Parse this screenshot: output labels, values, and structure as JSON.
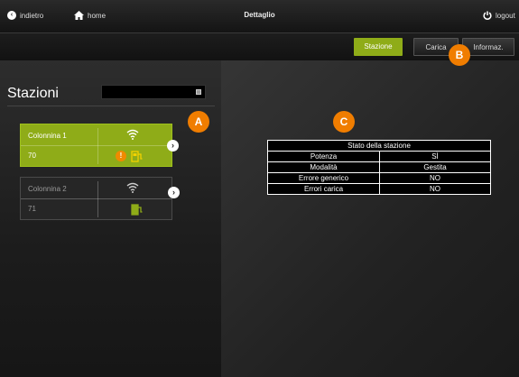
{
  "topbar": {
    "back_label": "indietro",
    "home_label": "home",
    "title": "Dettaglio",
    "logout_label": "logout"
  },
  "tabs": [
    {
      "label": "Stazione",
      "active": true
    },
    {
      "label": "Carica",
      "active": false
    },
    {
      "label": "Informaz.",
      "active": false
    }
  ],
  "stations_panel": {
    "title": "Stazioni",
    "select_value": "",
    "cards": [
      {
        "name": "Colonnina 1",
        "id": "70",
        "active": true,
        "wifi_icon": "wifi-icon",
        "warning_icon": "warning-icon",
        "plug_icon": "plug-icon"
      },
      {
        "name": "Colonnina 2",
        "id": "71",
        "active": false,
        "wifi_icon": "wifi-icon",
        "plug_icon": "plug-icon"
      }
    ]
  },
  "status_table": {
    "title": "Stato della stazione",
    "rows": [
      {
        "label": "Potenza",
        "value": "SÌ"
      },
      {
        "label": "Modalità",
        "value": "Gestita"
      },
      {
        "label": "Errore generico",
        "value": "NO"
      },
      {
        "label": "Errori carica",
        "value": "NO"
      }
    ]
  },
  "badges": {
    "a": "A",
    "b": "B",
    "c": "C"
  },
  "colors": {
    "accent_green": "#8fac18",
    "badge_orange": "#f07d00",
    "background": "#262626"
  }
}
